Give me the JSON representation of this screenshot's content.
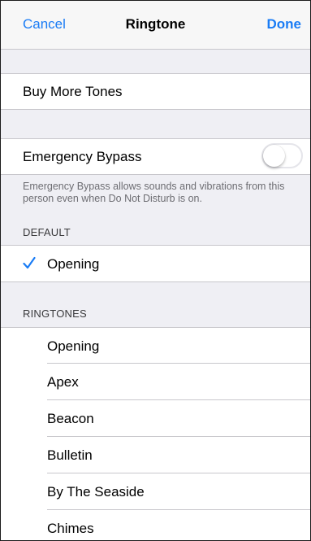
{
  "nav": {
    "cancel": "Cancel",
    "title": "Ringtone",
    "done": "Done"
  },
  "buy_more_tones": "Buy More Tones",
  "emergency_bypass": {
    "label": "Emergency Bypass",
    "enabled": false,
    "footnote": "Emergency Bypass allows sounds and vibrations from this person even when Do Not Disturb is on."
  },
  "default_section": {
    "header": "DEFAULT",
    "selected": "Opening",
    "check_icon": "checkmark-icon"
  },
  "ringtones_section": {
    "header": "RINGTONES",
    "items": [
      "Opening",
      "Apex",
      "Beacon",
      "Bulletin",
      "By The Seaside",
      "Chimes"
    ]
  },
  "colors": {
    "accent": "#1a7cf5",
    "background": "#efeff4",
    "separator": "#c8c7cc"
  }
}
